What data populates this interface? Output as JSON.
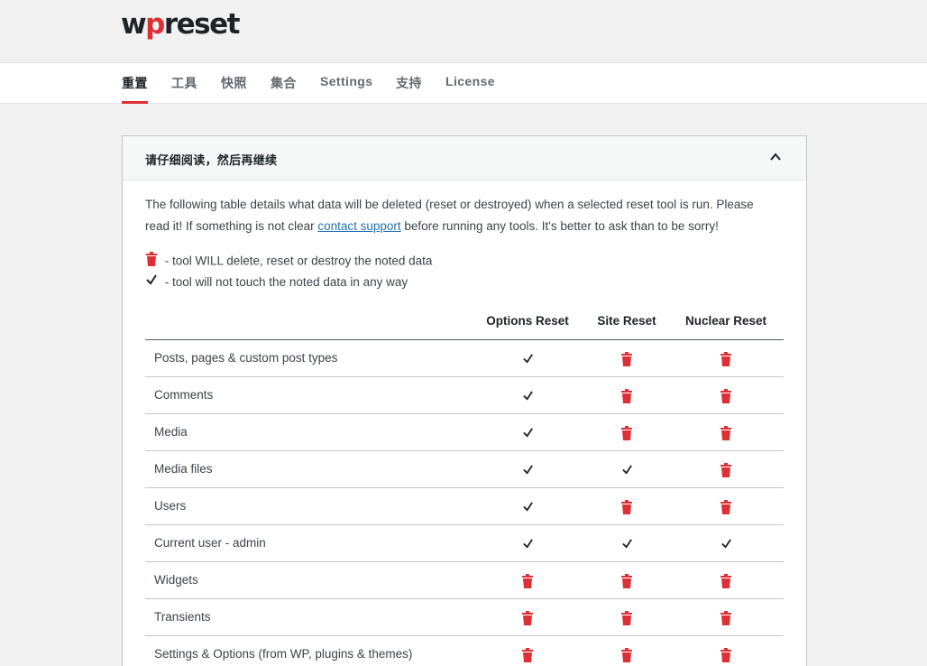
{
  "brand": {
    "logo_prefix": "w",
    "logo_mark": "p",
    "logo_suffix": "reset"
  },
  "nav": {
    "tabs": [
      {
        "label": "重置",
        "active": true
      },
      {
        "label": "工具"
      },
      {
        "label": "快照"
      },
      {
        "label": "集合"
      },
      {
        "label": "Settings"
      },
      {
        "label": "支持"
      },
      {
        "label": "License"
      }
    ]
  },
  "card": {
    "title": "请仔细阅读，然后再继续",
    "intro_before": "The following table details what data will be deleted (reset or destroyed) when a selected reset tool is run. Please read it! If something is not clear ",
    "intro_link": "contact support",
    "intro_after": " before running any tools. It's better to ask than to be sorry!",
    "legend_delete": " - tool WILL delete, reset or destroy the noted data",
    "legend_keep": " - tool will not touch the noted data in any way"
  },
  "table": {
    "columns": [
      "Options Reset",
      "Site Reset",
      "Nuclear Reset"
    ],
    "rows": [
      {
        "label": "Posts, pages & custom post types",
        "cells": [
          "check",
          "trash-icon",
          "trash-icon"
        ]
      },
      {
        "label": "Comments",
        "cells": [
          "check",
          "trash-icon",
          "trash-icon"
        ]
      },
      {
        "label": "Media",
        "cells": [
          "check",
          "trash-icon",
          "trash-icon"
        ]
      },
      {
        "label": "Media files",
        "cells": [
          "check",
          "check",
          "trash-icon"
        ]
      },
      {
        "label": "Users",
        "cells": [
          "check",
          "trash-icon",
          "trash-icon"
        ]
      },
      {
        "label": "Current user - admin",
        "cells": [
          "check",
          "check",
          "check"
        ]
      },
      {
        "label": "Widgets",
        "cells": [
          "trash-icon",
          "trash-icon",
          "trash-icon"
        ]
      },
      {
        "label": "Transients",
        "cells": [
          "trash-icon",
          "trash-icon",
          "trash-icon"
        ]
      },
      {
        "label": "Settings & Options (from WP, plugins & themes)",
        "cells": [
          "trash-icon",
          "trash-icon",
          "trash-icon"
        ]
      }
    ]
  },
  "colors": {
    "accent": "#dd3036",
    "text": "#3c434a",
    "link": "#2271b1"
  }
}
